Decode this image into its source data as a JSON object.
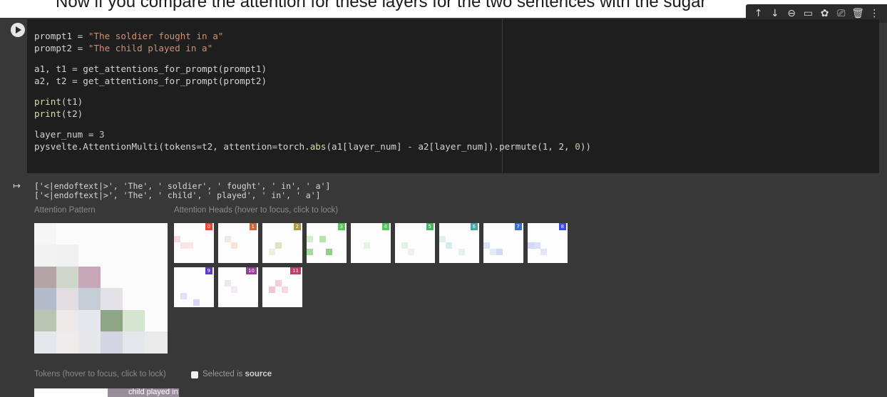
{
  "top_text": "Now if you compare the attention for these layers for the two sentences with the sugar",
  "toolbar": {
    "icons": [
      "arrow-up-icon",
      "arrow-down-icon",
      "link-icon",
      "comment-icon",
      "gear-icon",
      "mirror-icon",
      "trash-icon",
      "more-icon"
    ],
    "glyphs": [
      "↑",
      "↓",
      "⊖",
      "▭",
      "✿",
      "⎚",
      "🗑",
      "⋮"
    ]
  },
  "code": {
    "line1_var": "prompt1",
    "line1_op": " = ",
    "line1_str": "\"The soldier fought in a\"",
    "line2_var": "prompt2",
    "line2_op": " = ",
    "line2_str": "\"The child played in a\"",
    "line3": "a1, t1 = get_attentions_for_prompt(prompt1)",
    "line4": "a2, t2 = get_attentions_for_prompt(prompt2)",
    "line5_fn": "print",
    "line5_arg": "(t1)",
    "line6_fn": "print",
    "line6_arg": "(t2)",
    "line7_var": "layer_num = ",
    "line7_num": "3",
    "line8_a": "pysvelte.AttentionMulti(tokens=t2, attention=torch.",
    "line8_fn": "abs",
    "line8_b": "(a1[layer_num] - a2[layer_num]).permute(1, 2, ",
    "line8_num": "0",
    "line8_c": "))"
  },
  "output": {
    "line1": "['<|endoftext|>', 'The', ' soldier', ' fought', ' in', ' a']",
    "line2": "['<|endoftext|>', 'The', ' child', ' played', ' in', ' a']"
  },
  "labels": {
    "attention_pattern": "Attention Pattern",
    "attention_heads": "Attention Heads (hover to focus, click to lock)",
    "tokens": "Tokens (hover to focus, click to lock)",
    "selected_is": "Selected is ",
    "source": "source"
  },
  "heads": [
    {
      "label": "0",
      "color": "#e8463a"
    },
    {
      "label": "1",
      "color": "#c8673a"
    },
    {
      "label": "2",
      "color": "#a89a48"
    },
    {
      "label": "3",
      "color": "#5cc45c"
    },
    {
      "label": "4",
      "color": "#58c45a"
    },
    {
      "label": "5",
      "color": "#4fb06a"
    },
    {
      "label": "6",
      "color": "#47a3a0"
    },
    {
      "label": "7",
      "color": "#3e6fd0"
    },
    {
      "label": "8",
      "color": "#3a4ce0"
    },
    {
      "label": "9",
      "color": "#5a3cc4"
    },
    {
      "label": "10",
      "color": "#9a3c9a"
    },
    {
      "label": "11",
      "color": "#c43a6a"
    }
  ],
  "token_strip_text": "child  played  in"
}
